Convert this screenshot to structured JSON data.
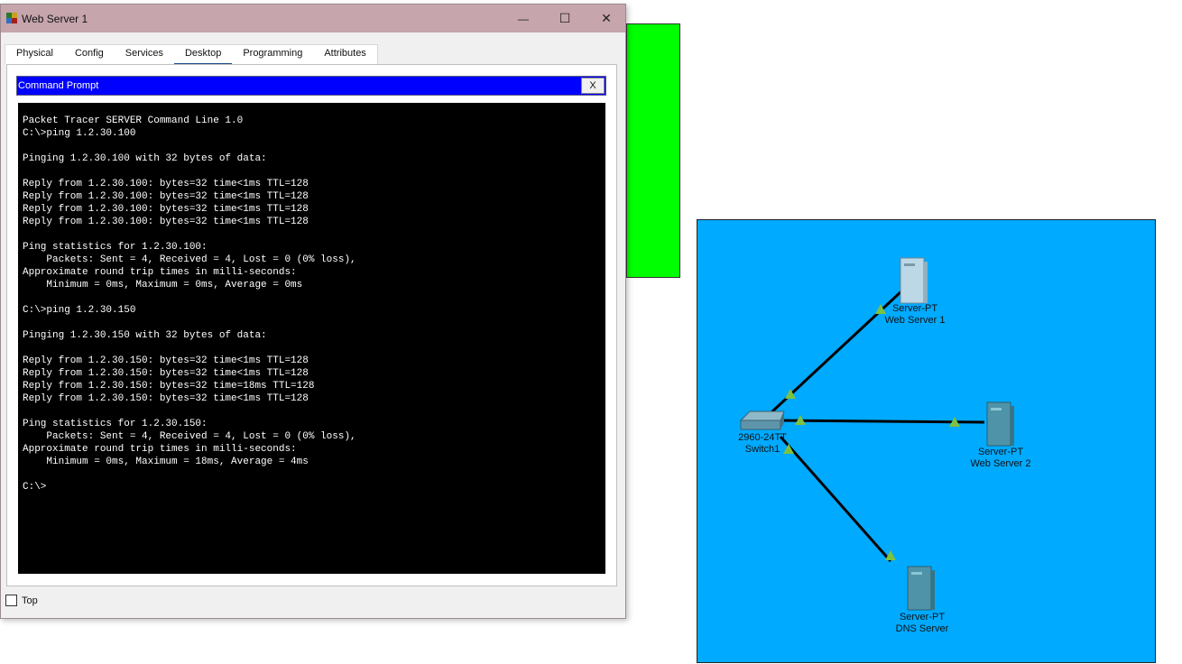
{
  "window": {
    "title": "Web Server 1",
    "controls": {
      "minimize": "—",
      "maximize": "☐",
      "close": "✕"
    }
  },
  "tabs": [
    {
      "label": "Physical",
      "active": false
    },
    {
      "label": "Config",
      "active": false
    },
    {
      "label": "Services",
      "active": false
    },
    {
      "label": "Desktop",
      "active": true
    },
    {
      "label": "Programming",
      "active": false
    },
    {
      "label": "Attributes",
      "active": false
    }
  ],
  "command_prompt": {
    "title": "Command Prompt",
    "close_label": "X",
    "lines": [
      "Packet Tracer SERVER Command Line 1.0",
      "C:\\>ping 1.2.30.100",
      "",
      "Pinging 1.2.30.100 with 32 bytes of data:",
      "",
      "Reply from 1.2.30.100: bytes=32 time<1ms TTL=128",
      "Reply from 1.2.30.100: bytes=32 time<1ms TTL=128",
      "Reply from 1.2.30.100: bytes=32 time<1ms TTL=128",
      "Reply from 1.2.30.100: bytes=32 time<1ms TTL=128",
      "",
      "Ping statistics for 1.2.30.100:",
      "    Packets: Sent = 4, Received = 4, Lost = 0 (0% loss),",
      "Approximate round trip times in milli-seconds:",
      "    Minimum = 0ms, Maximum = 0ms, Average = 0ms",
      "",
      "C:\\>ping 1.2.30.150",
      "",
      "Pinging 1.2.30.150 with 32 bytes of data:",
      "",
      "Reply from 1.2.30.150: bytes=32 time<1ms TTL=128",
      "Reply from 1.2.30.150: bytes=32 time<1ms TTL=128",
      "Reply from 1.2.30.150: bytes=32 time=18ms TTL=128",
      "Reply from 1.2.30.150: bytes=32 time<1ms TTL=128",
      "",
      "Ping statistics for 1.2.30.150:",
      "    Packets: Sent = 4, Received = 4, Lost = 0 (0% loss),",
      "Approximate round trip times in milli-seconds:",
      "    Minimum = 0ms, Maximum = 18ms, Average = 4ms",
      "",
      "C:\\>"
    ]
  },
  "top_checkbox": {
    "label": "Top",
    "checked": false
  },
  "topology": {
    "background": "#00aaff",
    "link_color": "#000000",
    "port_color": "#7cc242",
    "nodes": [
      {
        "id": "web1",
        "model": "Server-PT",
        "name": "Web Server 1"
      },
      {
        "id": "web2",
        "model": "Server-PT",
        "name": "Web Server 2"
      },
      {
        "id": "dns",
        "model": "Server-PT",
        "name": "DNS Server"
      },
      {
        "id": "switch1",
        "model": "2960-24TT",
        "name": "Switch1"
      }
    ]
  },
  "colors": {
    "titlebar": "#c6a5ad",
    "cmd_header": "#0000ff",
    "terminal_bg": "#000000",
    "green_area": "#00ff00"
  }
}
